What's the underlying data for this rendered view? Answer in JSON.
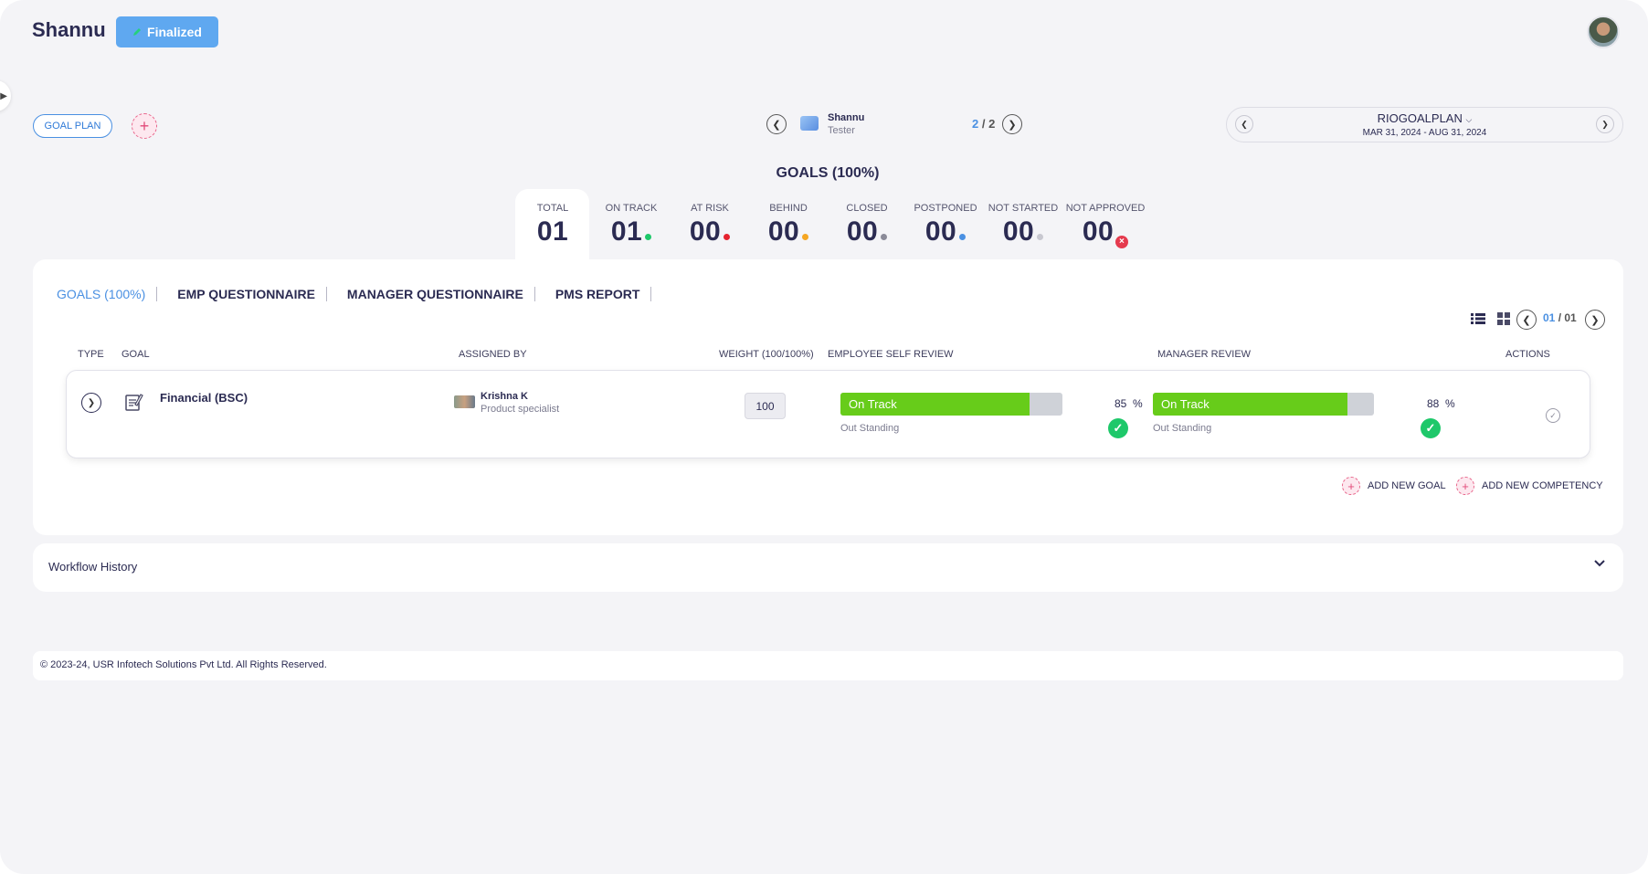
{
  "header": {
    "title": "Shannu",
    "status_label": "Finalized",
    "status_icon": "pencil-icon",
    "colors": {
      "status_bg": "#5fa8f0",
      "accent": "#4a90e2"
    }
  },
  "toolbar": {
    "goal_plan_label": "GOAL PLAN",
    "add_icon": "+"
  },
  "employee": {
    "name": "Shannu",
    "role": "Tester",
    "page_current": "2",
    "page_sep": " / ",
    "page_total": "2"
  },
  "plan": {
    "name": "RIOGOALPLAN",
    "range": "MAR 31, 2024 - AUG 31, 2024"
  },
  "goals_heading": "GOALS (100%)",
  "stats": [
    {
      "label": "TOTAL",
      "value": "01",
      "dot": ""
    },
    {
      "label": "ON TRACK",
      "value": "01",
      "dot": "#1ec86a"
    },
    {
      "label": "AT RISK",
      "value": "00",
      "dot": "#e5232f"
    },
    {
      "label": "BEHIND",
      "value": "00",
      "dot": "#f5a623"
    },
    {
      "label": "CLOSED",
      "value": "00",
      "dot": "#8a8a98"
    },
    {
      "label": "POSTPONED",
      "value": "00",
      "dot": "#4a90e2"
    },
    {
      "label": "NOT STARTED",
      "value": "00",
      "dot": "#c8c8d0"
    },
    {
      "label": "NOT APPROVED",
      "value": "00",
      "dot": "x"
    }
  ],
  "tabs": [
    {
      "label": "GOALS (100%)",
      "active": true
    },
    {
      "label": "EMP QUESTIONNAIRE",
      "active": false
    },
    {
      "label": "MANAGER QUESTIONNAIRE",
      "active": false
    },
    {
      "label": "PMS REPORT",
      "active": false
    }
  ],
  "list_pager": {
    "current": "01",
    "sep": " / ",
    "total": "01"
  },
  "columns": {
    "type": "TYPE",
    "goal": "GOAL",
    "assigned_by": "ASSIGNED BY",
    "weight": "WEIGHT (100/100%)",
    "self_review": "EMPLOYEE SELF REVIEW",
    "manager_review": "MANAGER REVIEW",
    "actions": "ACTIONS"
  },
  "goal_rows": [
    {
      "goal": "Financial (BSC)",
      "assigned_name": "Krishna K",
      "assigned_role": "Product specialist",
      "weight": "100",
      "self_status": "On Track",
      "self_fill": 0.85,
      "self_rating": "Out Standing",
      "self_pct": "85",
      "manager_status": "On Track",
      "manager_fill": 0.88,
      "manager_rating": "Out Standing",
      "manager_pct": "88",
      "pct_unit": "%"
    }
  ],
  "add_links": {
    "goal": "ADD NEW GOAL",
    "competency": "ADD NEW COMPETENCY"
  },
  "workflow": {
    "title": "Workflow History"
  },
  "footer": {
    "text": "© 2023-24, USR Infotech Solutions Pvt Ltd. All Rights Reserved."
  }
}
